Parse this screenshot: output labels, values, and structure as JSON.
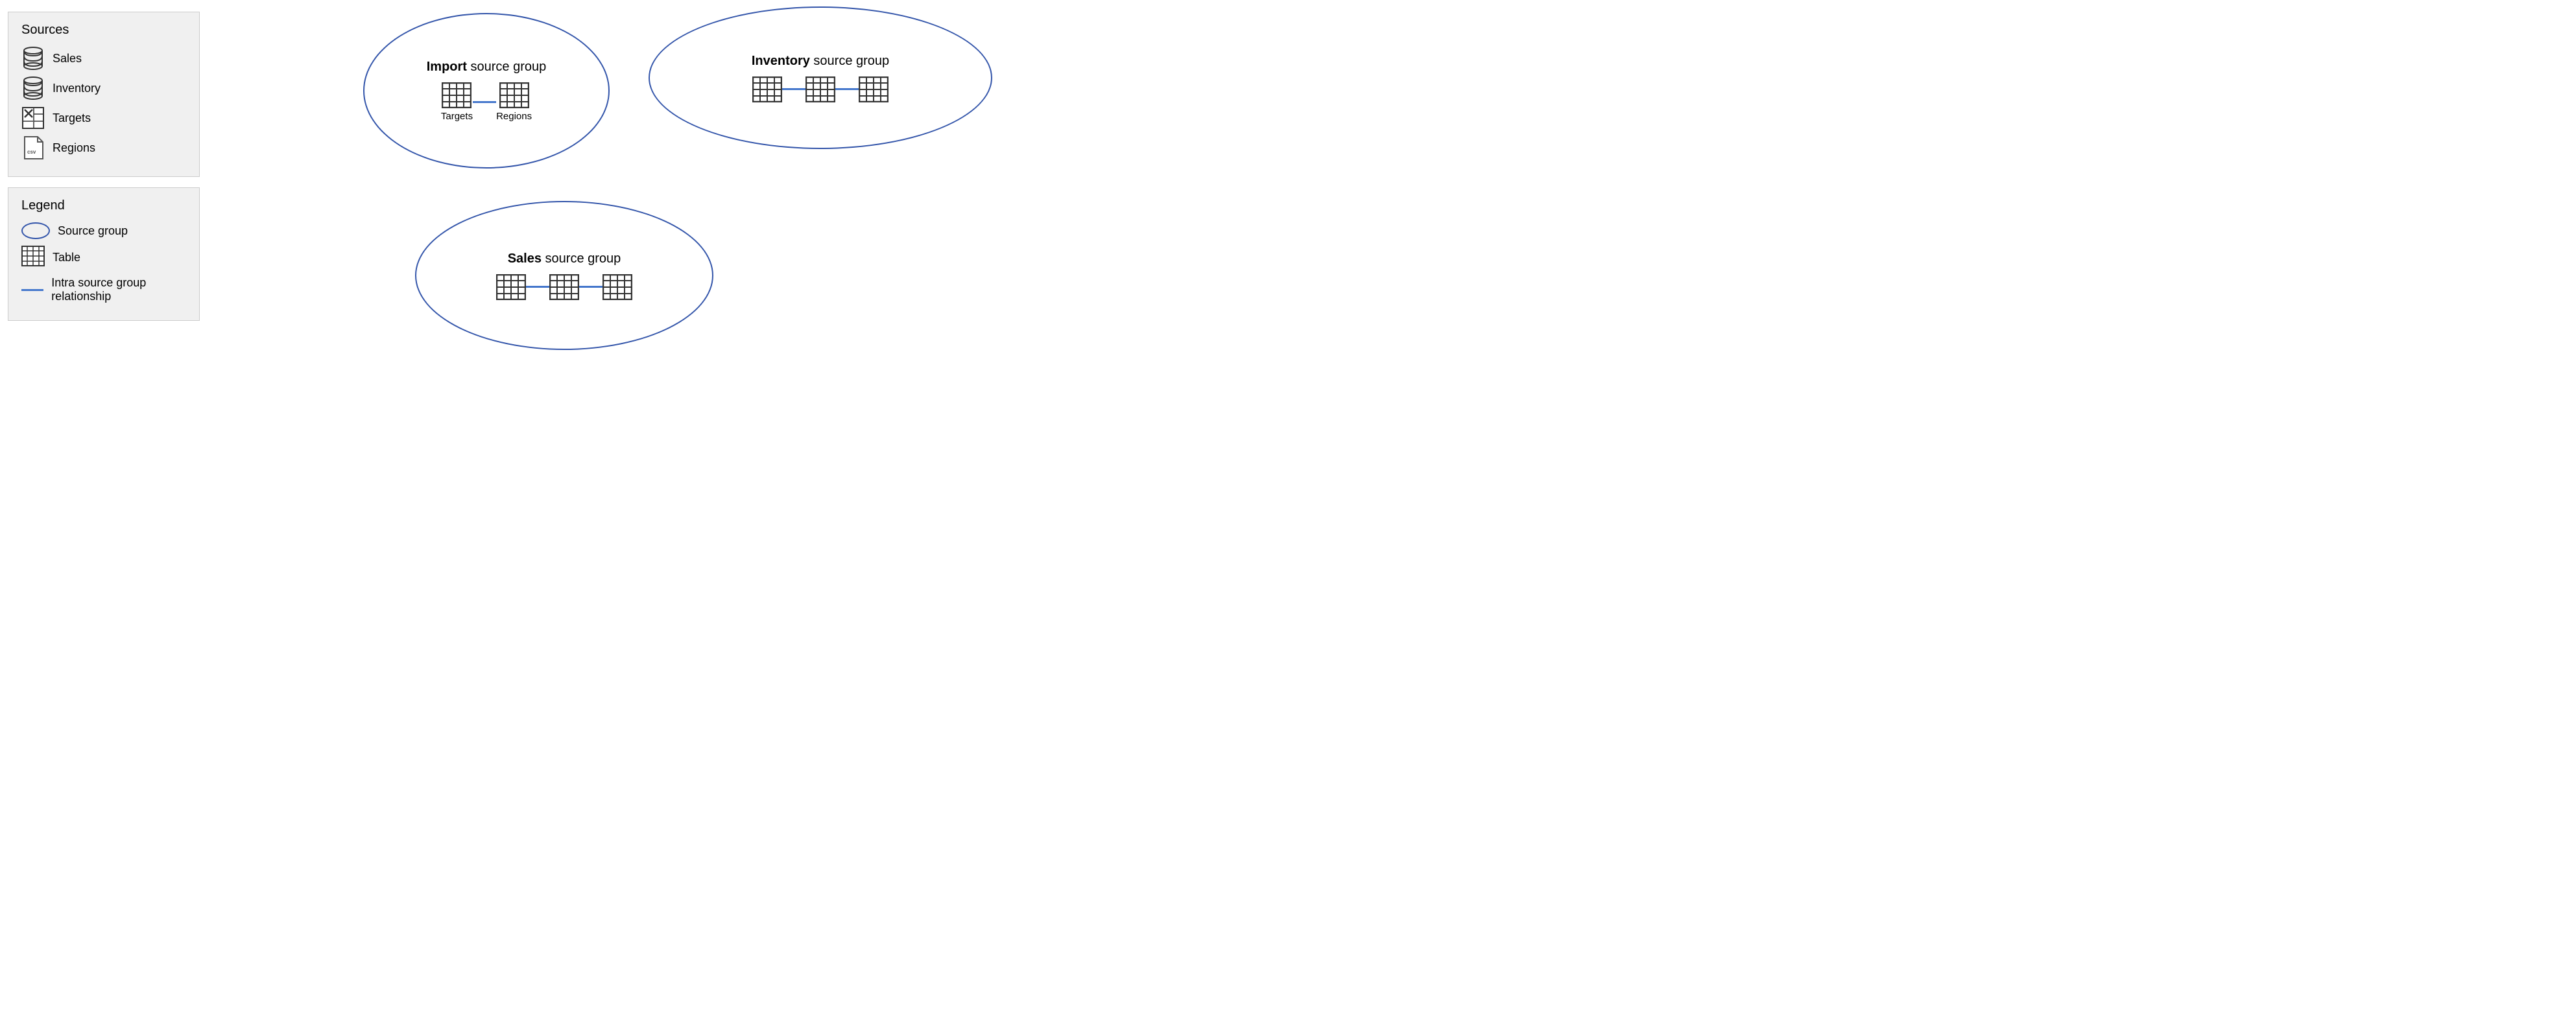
{
  "sources": {
    "title": "Sources",
    "items": [
      {
        "name": "Sales",
        "icon": "database"
      },
      {
        "name": "Inventory",
        "icon": "database"
      },
      {
        "name": "Targets",
        "icon": "excel"
      },
      {
        "name": "Regions",
        "icon": "csv"
      }
    ]
  },
  "legend": {
    "title": "Legend",
    "items": [
      {
        "icon": "oval",
        "label": "Source group"
      },
      {
        "icon": "table",
        "label": "Table"
      },
      {
        "icon": "line",
        "label": "Intra source group relationship"
      }
    ]
  },
  "groups": {
    "import": {
      "title_bold": "Import",
      "title_rest": " source group",
      "tables": [
        {
          "label": "Targets"
        },
        {
          "label": "Regions"
        }
      ]
    },
    "inventory": {
      "title_bold": "Inventory",
      "title_rest": " source group",
      "tables": [
        {
          "label": ""
        },
        {
          "label": ""
        },
        {
          "label": ""
        }
      ]
    },
    "sales": {
      "title_bold": "Sales",
      "title_rest": " source group",
      "tables": [
        {
          "label": ""
        },
        {
          "label": ""
        },
        {
          "label": ""
        }
      ]
    }
  },
  "colors": {
    "border": "#3355aa",
    "line": "#4477cc",
    "panel_bg": "#f0f0f0"
  }
}
